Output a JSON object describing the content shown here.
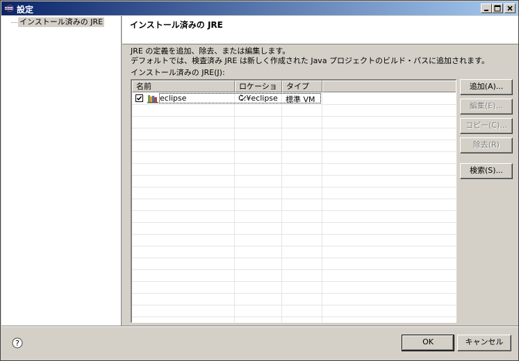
{
  "window": {
    "title": "設定",
    "icons": {
      "app": "eclipse-icon",
      "minimize": "minimize-icon",
      "maximize": "maximize-icon",
      "close": "close-icon"
    }
  },
  "tree": {
    "items": [
      {
        "label": "インストール済みの JRE",
        "selected": true
      }
    ]
  },
  "page": {
    "title": "インストール済みの JRE",
    "description_line1": "JRE の定義を追加、除去、または編集します。",
    "description_line2": "デフォルトでは、検査済み JRE は新しく作成された Java プロジェクトのビルド・パスに追加されます。",
    "installed_label": "インストール済みの JRE(J):"
  },
  "table": {
    "columns": [
      "名前",
      "ロケーション",
      "タイプ"
    ],
    "rows": [
      {
        "checked": true,
        "icon": "jre-library-icon",
        "name": "eclipse",
        "location": "C:¥eclipse",
        "type": "標準 VM"
      }
    ]
  },
  "buttons": {
    "add": {
      "label": "追加(A)...",
      "enabled": true
    },
    "edit": {
      "label": "編集(E)...",
      "enabled": false
    },
    "copy": {
      "label": "コピー(C)...",
      "enabled": false
    },
    "remove": {
      "label": "除去(R)",
      "enabled": false
    },
    "search": {
      "label": "検索(S)...",
      "enabled": true
    }
  },
  "footer": {
    "help_icon": "help-icon",
    "ok_label": "OK",
    "cancel_label": "キャンセル"
  },
  "colors": {
    "titlebar_start": "#0a246a",
    "titlebar_end": "#a6caf0",
    "face": "#d4d0c8"
  }
}
